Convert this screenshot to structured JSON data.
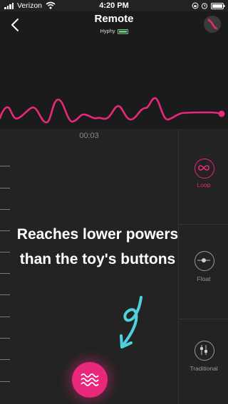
{
  "status_bar": {
    "carrier": "Verizon",
    "time": "4:20 PM"
  },
  "header": {
    "title": "Remote",
    "device_name": "Hyphy"
  },
  "timeline": {
    "elapsed": "00:03"
  },
  "overlay": {
    "caption": "Reaches lower powers than the toy's buttons"
  },
  "modes": [
    {
      "label": "Loop",
      "icon": "infinity-icon",
      "active": true
    },
    {
      "label": "Float",
      "icon": "float-icon",
      "active": false
    },
    {
      "label": "Traditional",
      "icon": "sliders-icon",
      "active": false
    }
  ],
  "colors": {
    "accent": "#e9287c",
    "annotation": "#4fd1e0",
    "battery": "#4cd964"
  }
}
